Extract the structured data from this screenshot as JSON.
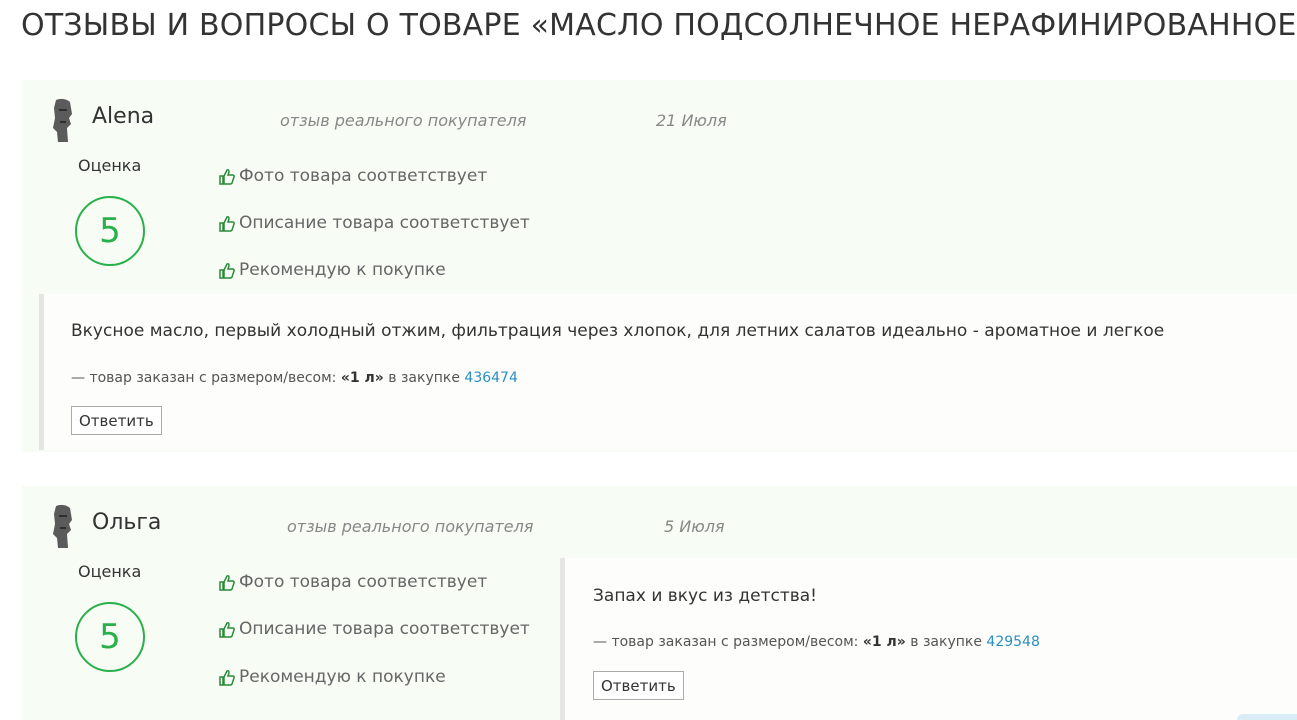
{
  "page": {
    "title": "ОТЗЫВЫ И ВОПРОСЫ О ТОВАРЕ «МАСЛО ПОДСОЛНЕЧНОЕ НЕРАФИНИРОВАННОЕ»"
  },
  "colors": {
    "accent": "#2ab04a",
    "link": "#2a8fc4",
    "panel": "#f7fcf5"
  },
  "reviews": [
    {
      "author": "Alena",
      "verified": "отзыв реального покупателя",
      "date": "21 Июля",
      "rating_label": "Оценка",
      "rating": "5",
      "features": [
        "Фото товара соответствует",
        "Описание товара соответствует",
        "Рекомендую к покупке"
      ],
      "text": "Вкусное масло, первый холодный отжим, фильтрация через хлопок, для летних салатов идеально - ароматное и легкое",
      "meta_prefix": "—  товар заказан с размером/весом: ",
      "size": "«1 л»",
      "meta_middle": " в закупке ",
      "purchase_id": "436474",
      "reply_label": "Ответить"
    },
    {
      "author": "Ольга",
      "verified": "отзыв реального покупателя",
      "date": "5 Июля",
      "rating_label": "Оценка",
      "rating": "5",
      "features": [
        "Фото товара соответствует",
        "Описание товара соответствует",
        "Рекомендую к покупке"
      ],
      "text": "Запах и вкус из детства!",
      "meta_prefix": "—  товар заказан с размером/весом: ",
      "size": "«1 л»",
      "meta_middle": " в закупке ",
      "purchase_id": "429548",
      "reply_label": "Ответить"
    }
  ]
}
